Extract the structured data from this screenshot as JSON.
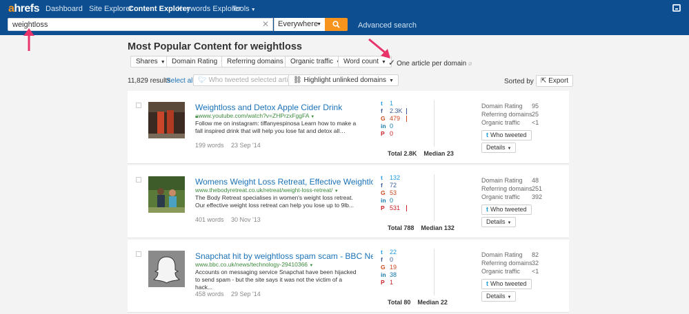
{
  "nav": {
    "logo": "ahrefs",
    "dashboard": "Dashboard",
    "site_explorer": "Site Explorer",
    "content_explorer": "Content Explorer",
    "keywords_explorer": "Keywords Explorer",
    "tools": "Tools"
  },
  "search": {
    "query": "weightloss",
    "scope": "Everywhere",
    "advanced": "Advanced search"
  },
  "page": {
    "title": "Most Popular Content for weightloss"
  },
  "filters": {
    "shares": "Shares",
    "domain_rating": "Domain Rating",
    "referring_domains": "Referring domains",
    "organic_traffic": "Organic traffic",
    "word_count": "Word count",
    "one_per_domain": "One article per domain"
  },
  "toolbar": {
    "results": "11,829 results",
    "select_all": "Select all",
    "who_tweeted_selected": "Who tweeted selected articles",
    "highlight_unlinked": "Highlight unlinked domains",
    "sorted_by": "Sorted by",
    "export": "Export"
  },
  "labels": {
    "domain_rating": "Domain Rating",
    "referring_domains": "Referring domains",
    "organic_traffic": "Organic traffic",
    "who_tweeted": "Who tweeted",
    "details": "Details"
  },
  "results": [
    {
      "title": "Weightloss and Detox Apple Cider Drink",
      "url": "www.youtube.com/watch?v=ZHPrzxFggFA",
      "desc": "Follow me on instagram: tiffanyespinosa Learn how to make a fall inspired drink that will help you lose fat and detox all…",
      "words": "199 words",
      "date": "23 Sep '14",
      "twitter": "1",
      "facebook": "2.3K",
      "google": "479",
      "linkedin": "0",
      "pinterest": "0",
      "total": "Total 2.8K",
      "median": "Median 23",
      "dr": "95",
      "rd": "25",
      "ot": "<1"
    },
    {
      "title": "Womens Weight Loss Retreat, Effective Weightloss R...",
      "url": "www.thebodyretreat.co.uk/retreat/weight-loss-retreat/",
      "desc": "The Body Retreat specialises in women's weight loss retreat. Our effective weight loss retreat can help you lose up to 9lb...",
      "words": "401 words",
      "date": "30 Nov '13",
      "twitter": "132",
      "facebook": "72",
      "google": "53",
      "linkedin": "0",
      "pinterest": "531",
      "total": "Total 788",
      "median": "Median 132",
      "dr": "48",
      "rd": "251",
      "ot": "392"
    },
    {
      "title": "Snapchat hit by weightloss spam scam - BBC News",
      "url": "www.bbc.co.uk/news/technology-29410366",
      "desc": "Accounts on messaging service Snapchat have been hijacked to send spam - but the site says it was not the victim of a hack...",
      "words": "458 words",
      "date": "29 Sep '14",
      "twitter": "22",
      "facebook": "0",
      "google": "19",
      "linkedin": "38",
      "pinterest": "1",
      "total": "Total 80",
      "median": "Median 22",
      "dr": "82",
      "rd": "32",
      "ot": "<1"
    }
  ],
  "colors": {
    "nav_bg": "#0c4e8f",
    "accent": "#f7941d",
    "link": "#1b72b8",
    "url_green": "#3c8a3c",
    "annotation_arrow": "#e8336b"
  }
}
